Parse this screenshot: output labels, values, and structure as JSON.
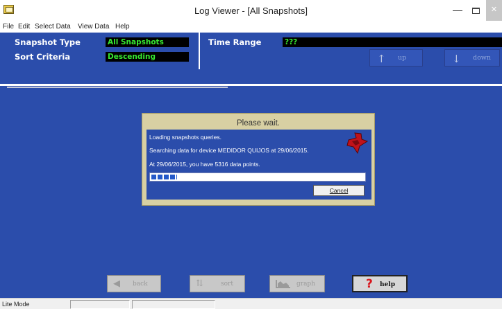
{
  "window": {
    "title": "Log Viewer - [All Snapshots]",
    "minimize_glyph": "—",
    "close_glyph": "✕",
    "icon": "app-window-icon"
  },
  "menu": [
    "File",
    "Edit",
    "Select Data",
    "View Data",
    "Help"
  ],
  "header": {
    "snapshot_type_label": "Snapshot Type",
    "snapshot_type_value": "All Snapshots",
    "sort_criteria_label": "Sort Criteria",
    "sort_criteria_value": "Descending",
    "time_range_label": "Time Range",
    "time_range_value": "???",
    "up_label": "up",
    "down_label": "down",
    "up_icon": "arrow-up-icon",
    "down_icon": "arrow-down-icon"
  },
  "dialog": {
    "title": "Please wait.",
    "lines": [
      "Loading snapshots queries.",
      "Searching data for device MEDIDOR QUIJOS at 29/06/2015.",
      "At 29/06/2015, you have 5316 data points."
    ],
    "progress": 0.12,
    "cancel_label": "Cancel",
    "icon": "lightning-bolt-icon"
  },
  "toolbar": {
    "back_label": "back",
    "sort_label": "sort",
    "graph_label": "graph",
    "help_label": "help",
    "help_glyph": "?"
  },
  "status": {
    "mode": "Lite Mode"
  },
  "colors": {
    "background_blue": "#2b4dab",
    "value_text_green": "#36e830",
    "dialog_beige": "#d8d0a3",
    "progress_blue": "#2459c9",
    "help_red": "#d8141b"
  }
}
